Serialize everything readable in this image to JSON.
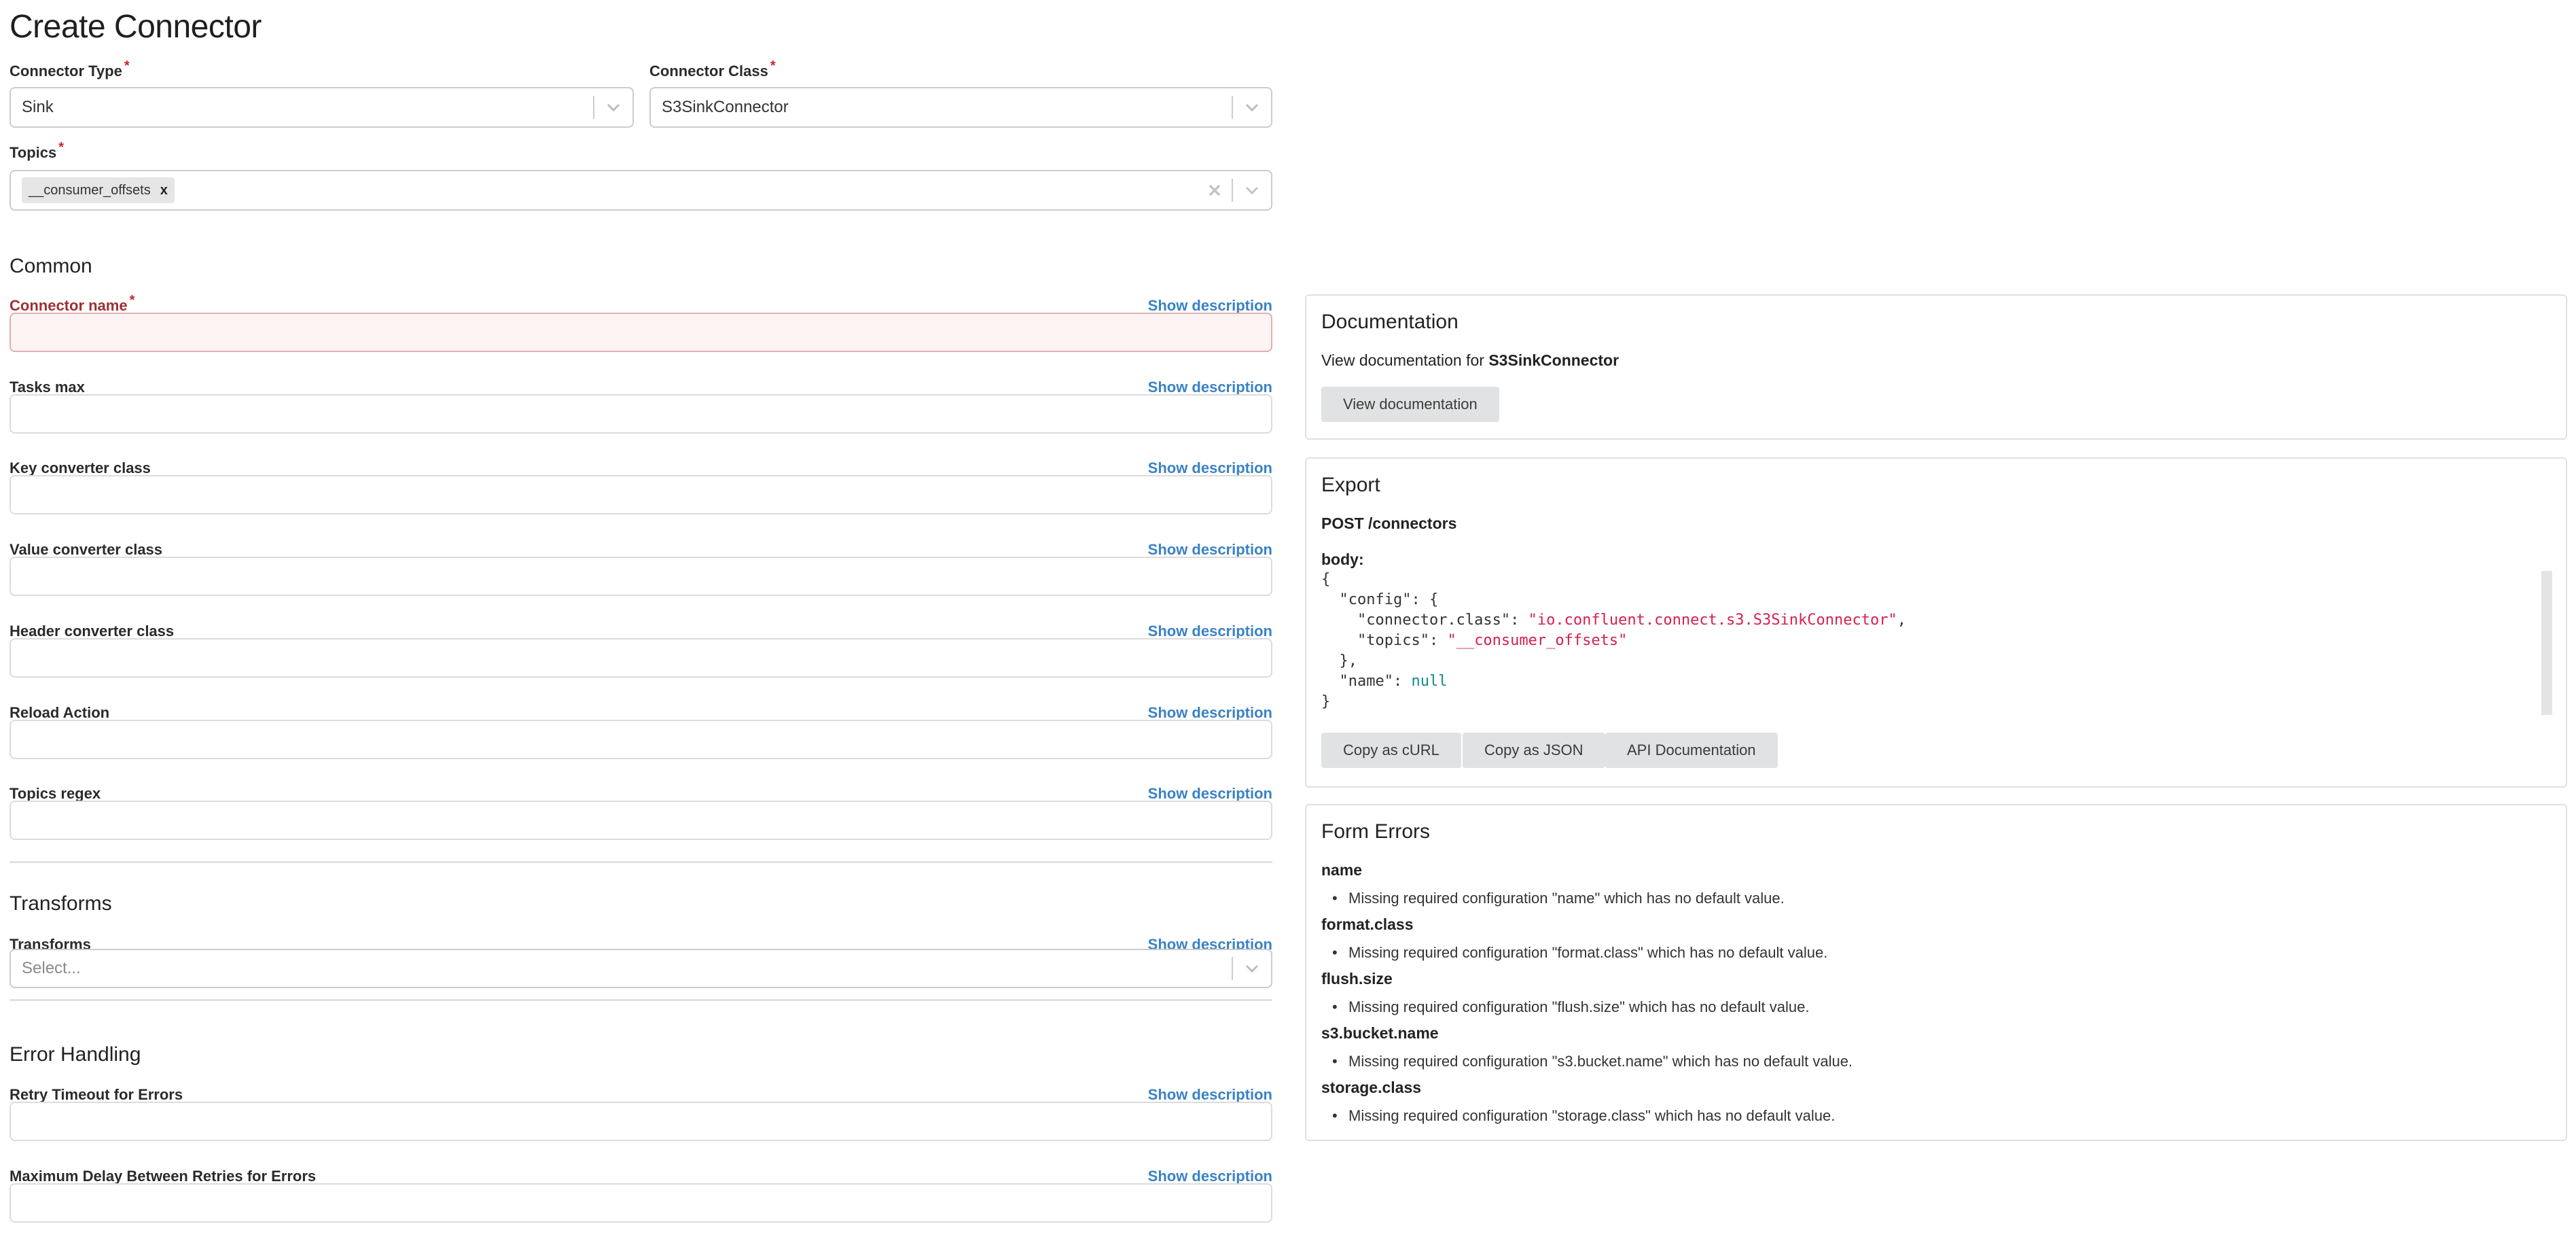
{
  "page": {
    "title": "Create Connector"
  },
  "top_fields": {
    "connector_type": {
      "label": "Connector Type",
      "value": "Sink",
      "required": "*"
    },
    "connector_class": {
      "label": "Connector Class",
      "value": "S3SinkConnector",
      "required": "*"
    },
    "topics": {
      "label": "Topics",
      "required": "*",
      "chips": [
        "__consumer_offsets"
      ],
      "chip_remove": "x"
    }
  },
  "sections": {
    "common": {
      "title": "Common",
      "fields": [
        {
          "label": "Connector name",
          "required": "*",
          "error": true,
          "value": ""
        },
        {
          "label": "Tasks max",
          "value": ""
        },
        {
          "label": "Key converter class",
          "value": ""
        },
        {
          "label": "Value converter class",
          "value": ""
        },
        {
          "label": "Header converter class",
          "value": ""
        },
        {
          "label": "Reload Action",
          "value": ""
        },
        {
          "label": "Topics regex",
          "value": ""
        }
      ]
    },
    "transforms": {
      "title": "Transforms",
      "field": {
        "label": "Transforms",
        "placeholder": "Select..."
      }
    },
    "error_handling": {
      "title": "Error Handling",
      "fields": [
        {
          "label": "Retry Timeout for Errors",
          "value": ""
        },
        {
          "label": "Maximum Delay Between Retries for Errors",
          "value": ""
        }
      ]
    }
  },
  "show_description": "Show description",
  "documentation": {
    "title": "Documentation",
    "text_prefix": "View documentation for",
    "connector": "S3SinkConnector",
    "button": "View documentation"
  },
  "export": {
    "title": "Export",
    "endpoint": "POST /connectors",
    "body_label": "body:",
    "code": {
      "open": "{",
      "config_key": "\"config\"",
      "connector_class_key": "\"connector.class\"",
      "connector_class_value": "\"io.confluent.connect.s3.S3SinkConnector\"",
      "topics_key": "\"topics\"",
      "topics_value": "\"__consumer_offsets\"",
      "name_key": "\"name\"",
      "name_value": "null",
      "close": "}"
    },
    "buttons": [
      "Copy as cURL",
      "Copy as JSON",
      "API Documentation"
    ]
  },
  "form_errors": {
    "title": "Form Errors",
    "items": [
      {
        "key": "name",
        "message": "Missing required configuration \"name\" which has no default value."
      },
      {
        "key": "format.class",
        "message": "Missing required configuration \"format.class\" which has no default value."
      },
      {
        "key": "flush.size",
        "message": "Missing required configuration \"flush.size\" which has no default value."
      },
      {
        "key": "s3.bucket.name",
        "message": "Missing required configuration \"s3.bucket.name\" which has no default value."
      },
      {
        "key": "storage.class",
        "message": "Missing required configuration \"storage.class\" which has no default value."
      }
    ]
  },
  "colors": {
    "link": "#3a82c6",
    "required": "#d0202a",
    "error_label": "#9e3033",
    "error_border": "#e1b0b0",
    "error_bg": "#fdf4f3",
    "code_string": "#d6204e",
    "code_null": "#0f8a8a",
    "button_bg": "#e1e2e3"
  }
}
